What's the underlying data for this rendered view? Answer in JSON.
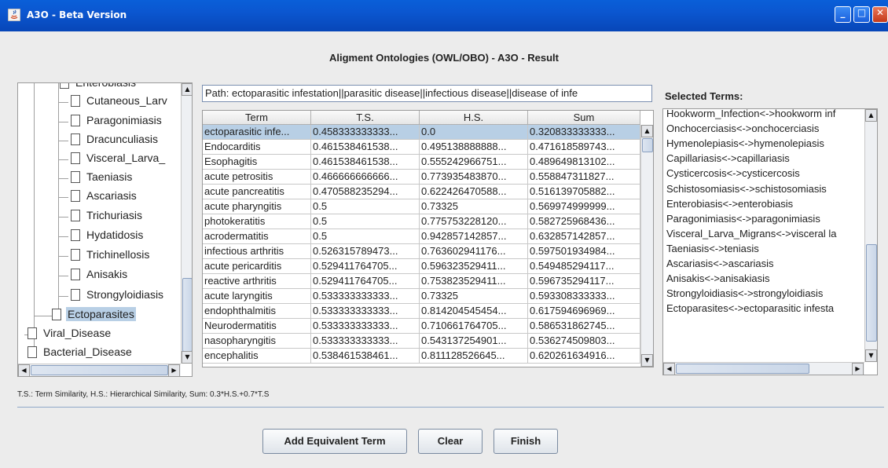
{
  "window": {
    "title": "A3O - Beta Version",
    "minimize": "_",
    "maximize": "□",
    "close": "✕"
  },
  "heading": "Aligment Ontologies (OWL/OBO) - A3O - Result",
  "tree": {
    "items": [
      "Enterobiasis",
      "Cutaneous_Larv",
      "Paragonimiasis",
      "Dracunculiasis",
      "Visceral_Larva_",
      "Taeniasis",
      "Ascariasis",
      "Trichuriasis",
      "Hydatidosis",
      "Trichinellosis",
      "Anisakis",
      "Strongyloidiasis",
      "Ectoparasites",
      "Viral_Disease",
      "Bacterial_Disease"
    ],
    "selected": "Ectoparasites"
  },
  "path_field": "Path: ectoparasitic infestation||parasitic disease||infectious disease||disease of infe",
  "table": {
    "headers": [
      "Term",
      "T.S.",
      "H.S.",
      "Sum"
    ],
    "rows": [
      [
        "ectoparasitic infe...",
        "0.458333333333...",
        "0.0",
        "0.320833333333..."
      ],
      [
        "Endocarditis",
        "0.461538461538...",
        "0.495138888888...",
        "0.471618589743..."
      ],
      [
        "Esophagitis",
        "0.461538461538...",
        "0.555242966751...",
        "0.489649813102..."
      ],
      [
        "acute petrositis",
        "0.466666666666...",
        "0.773935483870...",
        "0.558847311827..."
      ],
      [
        "acute pancreatitis",
        "0.470588235294...",
        "0.622426470588...",
        "0.516139705882..."
      ],
      [
        "acute pharyngitis",
        "0.5",
        "0.73325",
        "0.569974999999..."
      ],
      [
        "photokeratitis",
        "0.5",
        "0.775753228120...",
        "0.582725968436..."
      ],
      [
        "acrodermatitis",
        "0.5",
        "0.942857142857...",
        "0.632857142857..."
      ],
      [
        "infectious arthritis",
        "0.526315789473...",
        "0.763602941176...",
        "0.597501934984..."
      ],
      [
        "acute pericarditis",
        "0.529411764705...",
        "0.596323529411...",
        "0.549485294117..."
      ],
      [
        "reactive arthritis",
        "0.529411764705...",
        "0.753823529411...",
        "0.596735294117..."
      ],
      [
        "acute laryngitis",
        "0.533333333333...",
        "0.73325",
        "0.593308333333..."
      ],
      [
        "endophthalmitis",
        "0.533333333333...",
        "0.814204545454...",
        "0.617594696969..."
      ],
      [
        "Neurodermatitis",
        "0.533333333333...",
        "0.710661764705...",
        "0.586531862745..."
      ],
      [
        "nasopharyngitis",
        "0.533333333333...",
        "0.543137254901...",
        "0.536274509803..."
      ],
      [
        "encephalitis",
        "0.538461538461...",
        "0.811128526645...",
        "0.620261634916..."
      ]
    ],
    "selected_row": 0
  },
  "selected_terms": {
    "label": "Selected Terms:",
    "items": [
      "Hookworm_Infection<->hookworm inf",
      "Onchocerciasis<->onchocerciasis",
      "Hymenolepiasis<->hymenolepiasis",
      "Capillariasis<->capillariasis",
      "Cysticercosis<->cysticercosis",
      "Schistosomiasis<->schistosomiasis",
      "Enterobiasis<->enterobiasis",
      "Paragonimiasis<->paragonimiasis",
      "Visceral_Larva_Migrans<->visceral la",
      "Taeniasis<->teniasis",
      "Ascariasis<->ascariasis",
      "Anisakis<->anisakiasis",
      "Strongyloidiasis<->strongyloidiasis",
      "Ectoparasites<->ectoparasitic infesta"
    ]
  },
  "legend_note": "T.S.: Term Similarity, H.S.: Hierarchical Similarity, Sum: 0.3*H.S.+0.7*T.S",
  "buttons": {
    "add": "Add Equivalent Term",
    "clear": "Clear",
    "finish": "Finish"
  },
  "colors": {
    "titlebar": "#0b56d0",
    "selection": "#b8cfe5",
    "frame": "#ececec"
  }
}
